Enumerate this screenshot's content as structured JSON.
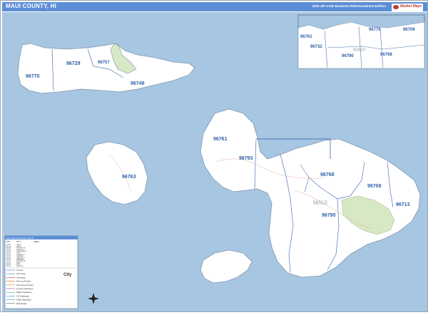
{
  "header": {
    "title": "MAUI COUNTY, HI",
    "subtitle": "2020 ZIP Code Business Reference/Inset Edition",
    "brand": "Market Maps"
  },
  "map": {
    "ocean_color": "#a7c6e1",
    "land_color": "#ffffff",
    "park_color": "#d6e8c4",
    "zip_label_color": "#2e5fa8",
    "main_zip_labels": [
      "96770",
      "96729",
      "96757",
      "96748",
      "96761",
      "96793",
      "96763",
      "96768",
      "96708",
      "96713",
      "96790"
    ],
    "region_label": "MAUI",
    "inset_zip_labels": [
      "96761",
      "96732",
      "96779",
      "96708",
      "96790",
      "96768"
    ],
    "inset_region_label": "MAUI"
  },
  "legend": {
    "title": "ZIP Code Reference Legend",
    "columns": [
      "ZIP",
      "CITY",
      "AREA"
    ],
    "rows": [
      [
        "96708",
        "HAIKU",
        ""
      ],
      [
        "96713",
        "HANA",
        ""
      ],
      [
        "96729",
        "HOOLEHUA",
        ""
      ],
      [
        "96732",
        "KAHULUI",
        ""
      ],
      [
        "96748",
        "KAUNAKAKAI",
        ""
      ],
      [
        "96753",
        "KIHEI",
        ""
      ],
      [
        "96757",
        "KUALAPUU",
        ""
      ],
      [
        "96761",
        "LAHAINA",
        ""
      ],
      [
        "96763",
        "LANAI CITY",
        ""
      ],
      [
        "96768",
        "MAKAWAO",
        ""
      ],
      [
        "96770",
        "MAUNALOA",
        ""
      ],
      [
        "96779",
        "PAIA",
        ""
      ],
      [
        "96790",
        "KULA",
        ""
      ],
      [
        "96793",
        "WAILUKU",
        ""
      ]
    ],
    "symbols": [
      "County",
      "ZIP Code",
      "Interstate",
      "Primary Roads",
      "Secondary Roads",
      "County Highways",
      "Major Highways",
      "US Highways",
      "State Highways",
      "Rail Roads"
    ],
    "scale_label": "City"
  }
}
